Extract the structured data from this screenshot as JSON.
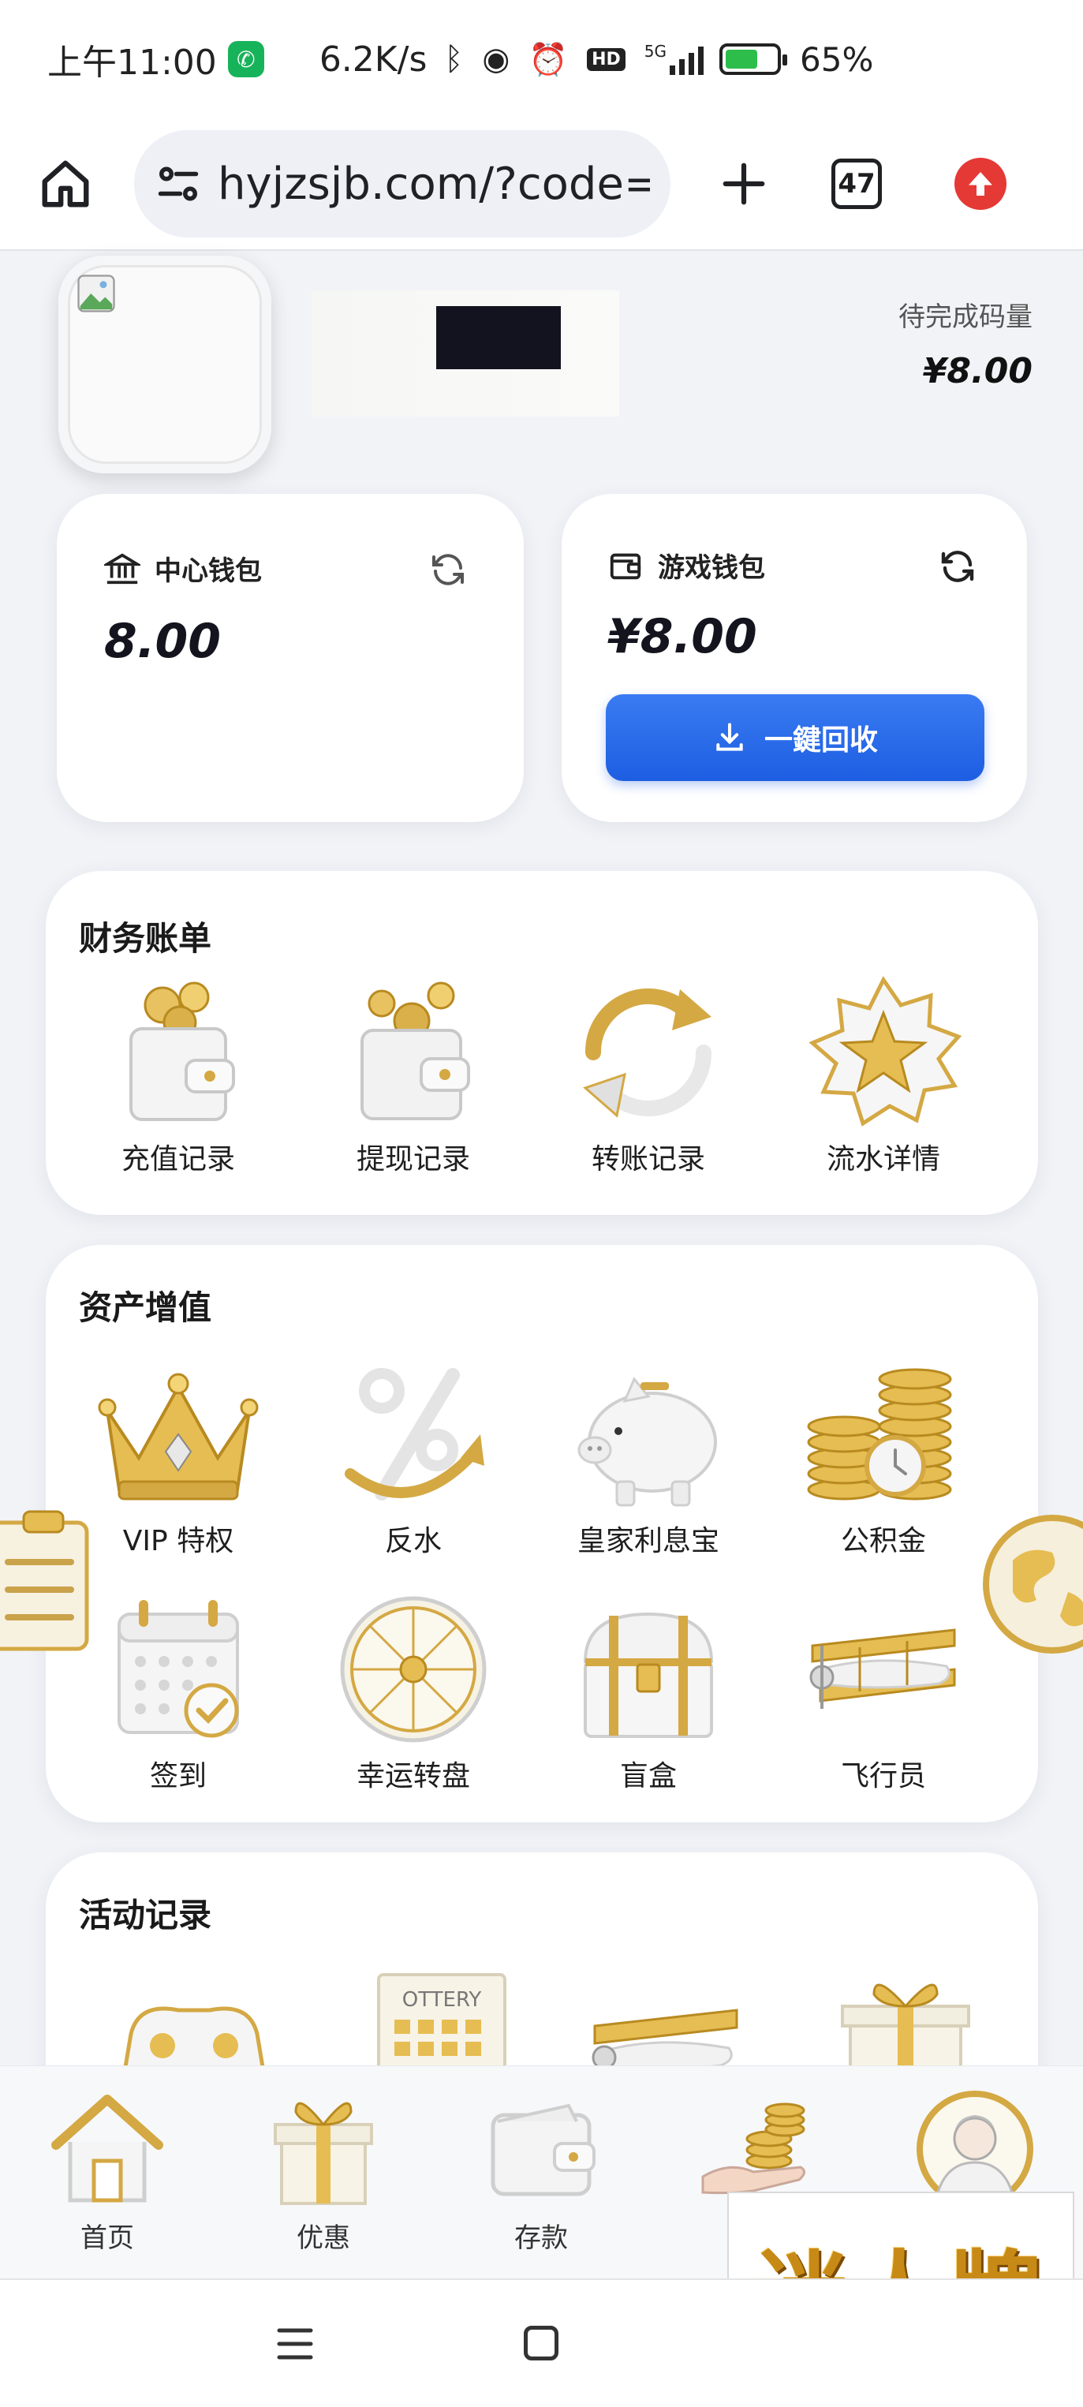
{
  "status_bar": {
    "time": "上午11:00",
    "net_speed": "6.2K/s",
    "signal_label": "5G",
    "hd_label": "HD",
    "battery_percent": "65%",
    "battery_level": 0.65
  },
  "browser": {
    "url": "hyjzsjb.com/?code=Z",
    "tab_count": "47"
  },
  "profile": {
    "pending_label": "待完成码量",
    "pending_value": "¥8.00"
  },
  "wallets": {
    "center": {
      "title": "中心钱包",
      "amount": "8.00"
    },
    "game": {
      "title": "游戏钱包",
      "amount": "¥8.00",
      "recover_label": "一鍵回收"
    }
  },
  "finance": {
    "title": "财务账单",
    "items": [
      {
        "label": "充值记录",
        "icon": "wallet-coins-icon"
      },
      {
        "label": "提现记录",
        "icon": "wallet-withdraw-icon"
      },
      {
        "label": "转账记录",
        "icon": "transfer-arrows-icon"
      },
      {
        "label": "流水详情",
        "icon": "star-badge-icon"
      }
    ]
  },
  "assets": {
    "title": "资产增值",
    "items": [
      {
        "label": "VIP 特权",
        "icon": "crown-icon"
      },
      {
        "label": "反水",
        "icon": "percent-icon"
      },
      {
        "label": "皇家利息宝",
        "icon": "piggy-bank-icon"
      },
      {
        "label": "公积金",
        "icon": "coin-stack-icon"
      },
      {
        "label": "签到",
        "icon": "calendar-check-icon"
      },
      {
        "label": "幸运转盘",
        "icon": "wheel-icon"
      },
      {
        "label": "盲盒",
        "icon": "treasure-chest-icon"
      },
      {
        "label": "飞行员",
        "icon": "airplane-icon"
      }
    ]
  },
  "activity": {
    "title": "活动记录",
    "lottery_text": "OTTERY"
  },
  "bottom_nav": [
    {
      "label": "首页",
      "icon": "home-icon"
    },
    {
      "label": "优惠",
      "icon": "gift-icon"
    },
    {
      "label": "存款",
      "icon": "wallet-icon"
    },
    {
      "label": "",
      "icon": "coins-hand-icon"
    },
    {
      "label": "",
      "icon": "user-avatar-icon"
    }
  ],
  "brand": {
    "text": "迷人牌"
  },
  "colors": {
    "accent_blue": "#1d5ee2",
    "gold": "#d4a843",
    "update_red": "#e53935"
  }
}
